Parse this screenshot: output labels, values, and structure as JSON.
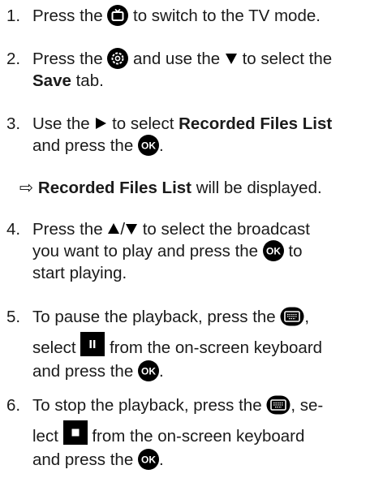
{
  "steps": [
    {
      "num": "1.",
      "a": "Press the",
      "b": "to switch to the TV mode.",
      "icon": "tv-button-icon"
    },
    {
      "num": "2.",
      "a": "Press the",
      "b": "and use the",
      "c": "to select the",
      "bold": "Save",
      "d": "tab.",
      "icons": [
        "settings-button-icon",
        "down-arrow-icon"
      ]
    },
    {
      "num": "3.",
      "a": "Use the",
      "b": "to select",
      "bold": "Recorded Files List",
      "c": "and press the",
      "d": ".",
      "icons": [
        "right-arrow-icon",
        "ok-button-icon"
      ]
    },
    {
      "num": "4.",
      "a": "Press the",
      "slash": "/",
      "b": "to select the broadcast",
      "c": "you want to play and press the",
      "d": "to",
      "e": "start playing.",
      "icons": [
        "up-arrow-icon",
        "down-arrow-icon",
        "ok-button-icon"
      ]
    },
    {
      "num": "5.",
      "a": "To pause the playback, press the",
      "b": ",",
      "c": "select",
      "d": "from the on-screen keyboard",
      "e": "and press the",
      "f": ".",
      "icons": [
        "keyboard-button-icon",
        "pause-key-icon",
        "ok-button-icon"
      ]
    },
    {
      "num": "6.",
      "a": "To stop the playback, press the",
      "b": ", se-",
      "c": "lect",
      "d": "from the on-screen keyboard",
      "e": "and press the",
      "f": ".",
      "icons": [
        "keyboard-button-icon",
        "stop-key-icon",
        "ok-button-icon"
      ]
    }
  ],
  "result": {
    "arrow": "⇨",
    "bold": "Recorded Files List",
    "text": "will be displayed."
  },
  "ok_label": "OK"
}
